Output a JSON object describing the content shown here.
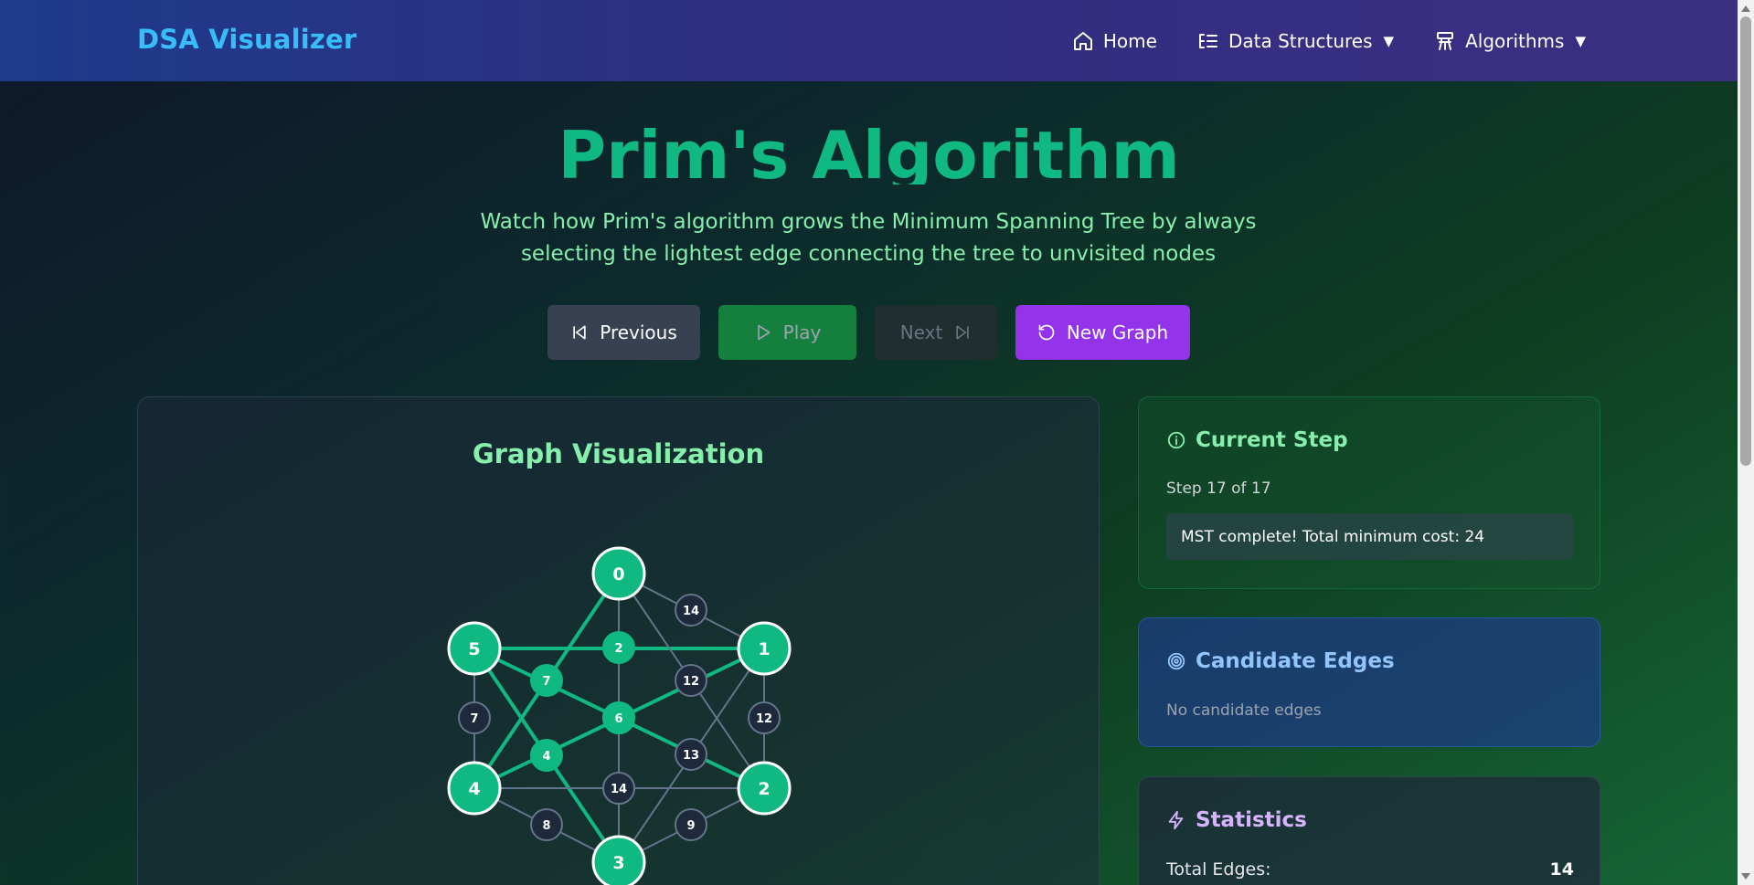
{
  "navbar": {
    "brand": "DSA Visualizer",
    "links": [
      {
        "label": "Home",
        "icon": "home-icon"
      },
      {
        "label": "Data Structures",
        "icon": "list-icon",
        "caret": "▼"
      },
      {
        "label": "Algorithms",
        "icon": "tree-icon",
        "caret": "▼"
      }
    ]
  },
  "hero": {
    "title": "Prim's Algorithm",
    "subtitle": "Watch how Prim's algorithm grows the Minimum Spanning Tree by always selecting the lightest edge connecting the tree to unvisited nodes"
  },
  "controls": {
    "previous": "Previous",
    "play": "Play",
    "next": "Next",
    "new_graph": "New Graph"
  },
  "visualization": {
    "title": "Graph Visualization",
    "colors": {
      "mst": "#10b981",
      "edge": "#64748b",
      "node_fill": "#10b981",
      "weight_fill": "#1e293b"
    },
    "nodes": [
      "0",
      "1",
      "2",
      "3",
      "4",
      "5"
    ],
    "edges": [
      {
        "from": "0",
        "to": "1",
        "weight": "14",
        "in_mst": false
      },
      {
        "from": "5",
        "to": "1",
        "weight": "2",
        "in_mst": true
      },
      {
        "from": "0",
        "to": "4",
        "weight": "7",
        "in_mst": true
      },
      {
        "from": "0",
        "to": "2",
        "weight": "12",
        "in_mst": false
      },
      {
        "from": "5",
        "to": "2",
        "weight": "6",
        "in_mst": true
      },
      {
        "from": "4",
        "to": "1",
        "weight": "6",
        "in_mst": true
      },
      {
        "from": "1",
        "to": "3",
        "weight": "13",
        "in_mst": false
      },
      {
        "from": "5",
        "to": "3",
        "weight": "4",
        "in_mst": true
      },
      {
        "from": "5",
        "to": "4",
        "weight": "7",
        "in_mst": false
      },
      {
        "from": "1",
        "to": "2",
        "weight": "12",
        "in_mst": false
      },
      {
        "from": "0",
        "to": "3",
        "weight": "14",
        "in_mst": false
      },
      {
        "from": "4",
        "to": "2",
        "weight": "14",
        "in_mst": false
      },
      {
        "from": "4",
        "to": "3",
        "weight": "8",
        "in_mst": false
      },
      {
        "from": "2",
        "to": "3",
        "weight": "9",
        "in_mst": false
      }
    ]
  },
  "current_step": {
    "title": "Current Step",
    "step_text": "Step 17 of 17",
    "message": "MST complete! Total minimum cost: 24"
  },
  "candidate_edges": {
    "title": "Candidate Edges",
    "empty_text": "No candidate edges"
  },
  "statistics": {
    "title": "Statistics",
    "rows": [
      {
        "label": "Total Edges:",
        "value": "14"
      }
    ]
  }
}
